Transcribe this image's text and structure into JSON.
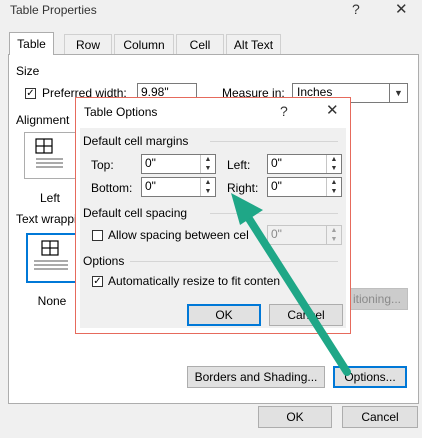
{
  "window": {
    "title": "Table Properties",
    "help_glyph": "?",
    "close_glyph": "✕"
  },
  "tabs": [
    {
      "label": "Table",
      "active": true
    },
    {
      "label": "Row",
      "active": false
    },
    {
      "label": "Column",
      "active": false
    },
    {
      "label": "Cell",
      "active": false
    },
    {
      "label": "Alt Text",
      "active": false
    }
  ],
  "size": {
    "group_label": "Size",
    "preferred_width_label": "Preferred width:",
    "preferred_width_checked": true,
    "preferred_width_value": "9.98\"",
    "measure_in_label": "Measure in:",
    "measure_in_value": "Inches"
  },
  "alignment": {
    "group_label": "Alignment",
    "left_label": "Left"
  },
  "text_wrapping": {
    "group_label": "Text wrapping",
    "visible_label": "Text wrappi",
    "none_label": "None"
  },
  "buttons": {
    "positioning": "Positioning...",
    "positioning_visible": "itioning...",
    "borders": "Borders and Shading...",
    "options": "Options...",
    "ok": "OK",
    "cancel": "Cancel"
  },
  "table_options": {
    "title": "Table Options",
    "help_glyph": "?",
    "close_glyph": "✕",
    "default_cell_margins_label": "Default cell margins",
    "top_label": "Top:",
    "top_value": "0\"",
    "bottom_label": "Bottom:",
    "bottom_value": "0\"",
    "left_label": "Left:",
    "left_value": "0\"",
    "right_label": "Right:",
    "right_value": "0\"",
    "default_cell_spacing_label": "Default cell spacing",
    "allow_spacing_label": "Allow spacing between cells",
    "allow_spacing_visible": "Allow spacing between cel",
    "allow_spacing_checked": false,
    "spacing_value": "0\"",
    "options_label": "Options",
    "auto_resize_label": "Automatically resize to fit contents",
    "auto_resize_visible": "Automatically resize to fit conten",
    "auto_resize_checked": true,
    "ok_label": "OK",
    "cancel_label": "Cancel",
    "cancel_visible": "Cancel"
  },
  "annotation": {
    "arrow_color": "#1fa787"
  }
}
